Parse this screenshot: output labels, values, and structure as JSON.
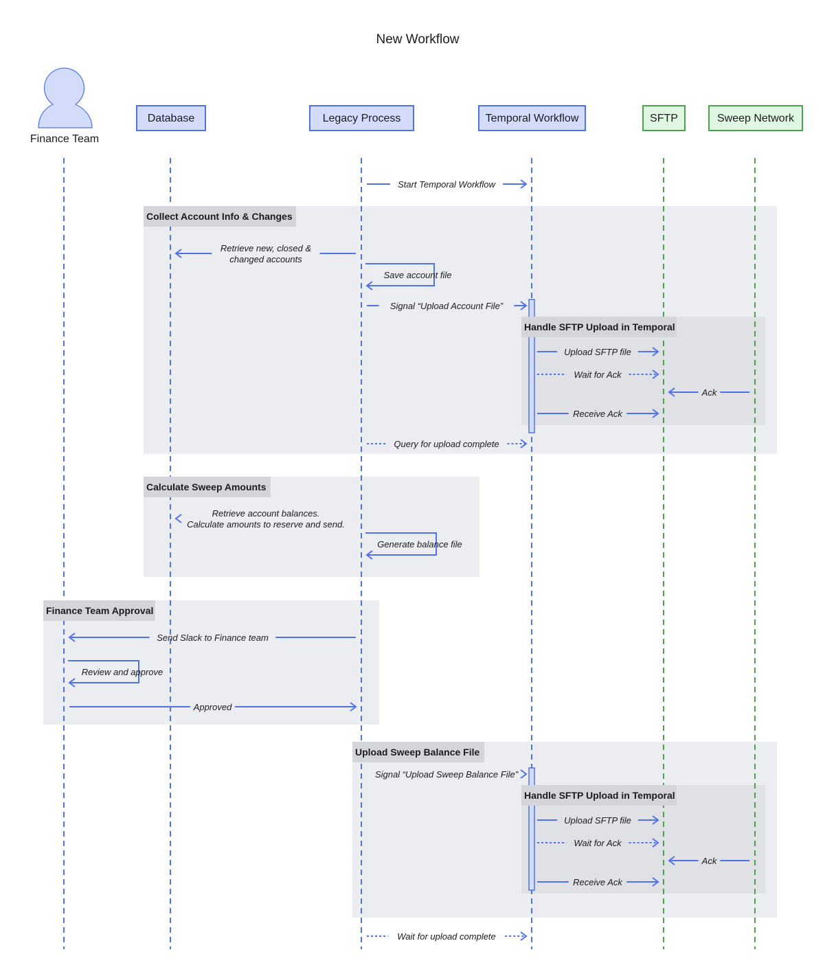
{
  "title": "New Workflow",
  "colors": {
    "blue": "#5072e8",
    "blue_fill": "#d3dcfb",
    "green": "#4aa24f",
    "green_fill": "#e0f7e1",
    "group_fill": "#ecedf1",
    "group_label_fill": "#d4d5da",
    "inner_group_fill": "#e0e1e5",
    "text": "#1b1b1f"
  },
  "participants": [
    {
      "id": "finance",
      "label": "Finance Team",
      "kind": "actor",
      "color": "blue"
    },
    {
      "id": "db",
      "label": "Database",
      "kind": "box",
      "color": "blue"
    },
    {
      "id": "legacy",
      "label": "Legacy Process",
      "kind": "box",
      "color": "blue"
    },
    {
      "id": "temporal",
      "label": "Temporal Workflow",
      "kind": "box",
      "color": "blue"
    },
    {
      "id": "sftp",
      "label": "SFTP",
      "kind": "box",
      "color": "green"
    },
    {
      "id": "sweep",
      "label": "Sweep Network",
      "kind": "box",
      "color": "green"
    }
  ],
  "groups": [
    {
      "label": "Collect Account Info & Changes",
      "level": 0
    },
    {
      "label": "Handle SFTP Upload in Temporal",
      "level": 1
    },
    {
      "label": "Calculate Sweep Amounts",
      "level": 0
    },
    {
      "label": "Finance Team Approval",
      "level": 0
    },
    {
      "label": "Upload Sweep Balance File",
      "level": 0
    },
    {
      "label": "Handle SFTP Upload in Temporal",
      "level": 1
    }
  ],
  "messages": [
    {
      "from": "legacy",
      "to": "temporal",
      "label": "Start Temporal Workflow",
      "style": "solid"
    },
    {
      "from": "legacy",
      "to": "db",
      "label": "Retrieve new, closed & changed accounts",
      "lines": [
        "Retrieve new, closed &",
        "changed accounts"
      ],
      "style": "solid"
    },
    {
      "from": "legacy",
      "to": "legacy",
      "label": "Save account file",
      "style": "self"
    },
    {
      "from": "legacy",
      "to": "temporal",
      "label": "Signal “Upload Account File”",
      "style": "solid"
    },
    {
      "from": "temporal",
      "to": "sftp",
      "label": "Upload SFTP file",
      "style": "solid"
    },
    {
      "from": "temporal",
      "to": "sftp",
      "label": "Wait for Ack",
      "style": "dotted"
    },
    {
      "from": "sweep",
      "to": "sftp",
      "label": "Ack",
      "style": "solid"
    },
    {
      "from": "temporal",
      "to": "sftp",
      "label": "Receive Ack",
      "style": "solid"
    },
    {
      "from": "legacy",
      "to": "temporal",
      "label": "Query for upload complete",
      "style": "dotted"
    },
    {
      "from": "legacy",
      "to": "db",
      "label": "Retrieve account balances. Calculate amounts to reserve and send.",
      "lines": [
        "Retrieve account balances.",
        "Calculate amounts to reserve and send."
      ],
      "style": "solid"
    },
    {
      "from": "legacy",
      "to": "legacy",
      "label": "Generate balance file",
      "style": "self"
    },
    {
      "from": "legacy",
      "to": "finance",
      "label": "Send Slack to Finance team",
      "style": "solid"
    },
    {
      "from": "finance",
      "to": "finance",
      "label": "Review and approve",
      "style": "self"
    },
    {
      "from": "finance",
      "to": "legacy",
      "label": "Approved",
      "style": "solid"
    },
    {
      "from": "legacy",
      "to": "temporal",
      "label": "Signal “Upload Sweep Balance File”",
      "style": "solid"
    },
    {
      "from": "temporal",
      "to": "sftp",
      "label": "Upload SFTP file",
      "style": "solid"
    },
    {
      "from": "temporal",
      "to": "sftp",
      "label": "Wait for Ack",
      "style": "dotted"
    },
    {
      "from": "sweep",
      "to": "sftp",
      "label": "Ack",
      "style": "solid"
    },
    {
      "from": "temporal",
      "to": "sftp",
      "label": "Receive Ack",
      "style": "solid"
    },
    {
      "from": "legacy",
      "to": "temporal",
      "label": "Wait for upload complete",
      "style": "dotted"
    }
  ]
}
